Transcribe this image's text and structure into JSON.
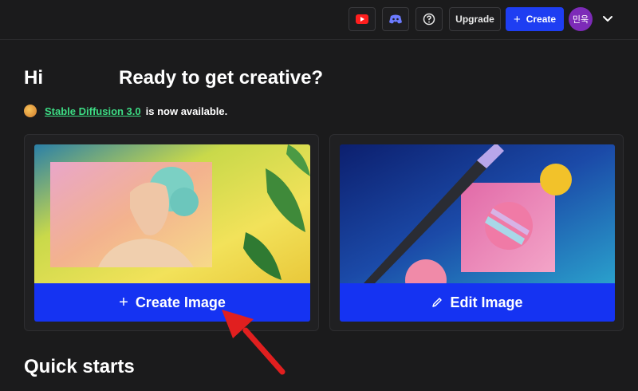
{
  "header": {
    "youtube_icon": "youtube-icon",
    "discord_icon": "discord-icon",
    "help_icon": "help-circle-icon",
    "upgrade_label": "Upgrade",
    "create_label": "Create",
    "avatar_text": "민욱",
    "menu_icon": "chevron-down-icon"
  },
  "greeting": {
    "hi": "Hi",
    "headline": "Ready to get creative?"
  },
  "notice": {
    "link_text": "Stable Diffusion 3.0",
    "suffix": "is now available."
  },
  "cards": [
    {
      "action_label": "Create Image",
      "icon": "plus-icon"
    },
    {
      "action_label": "Edit Image",
      "icon": "pencil-icon"
    }
  ],
  "section": {
    "quick_starts": "Quick starts"
  },
  "colors": {
    "background": "#1b1b1c",
    "primary": "#1533f2",
    "link": "#3ddc84",
    "avatar": "#7d2bb8",
    "annotation_arrow": "#e11f1f"
  }
}
